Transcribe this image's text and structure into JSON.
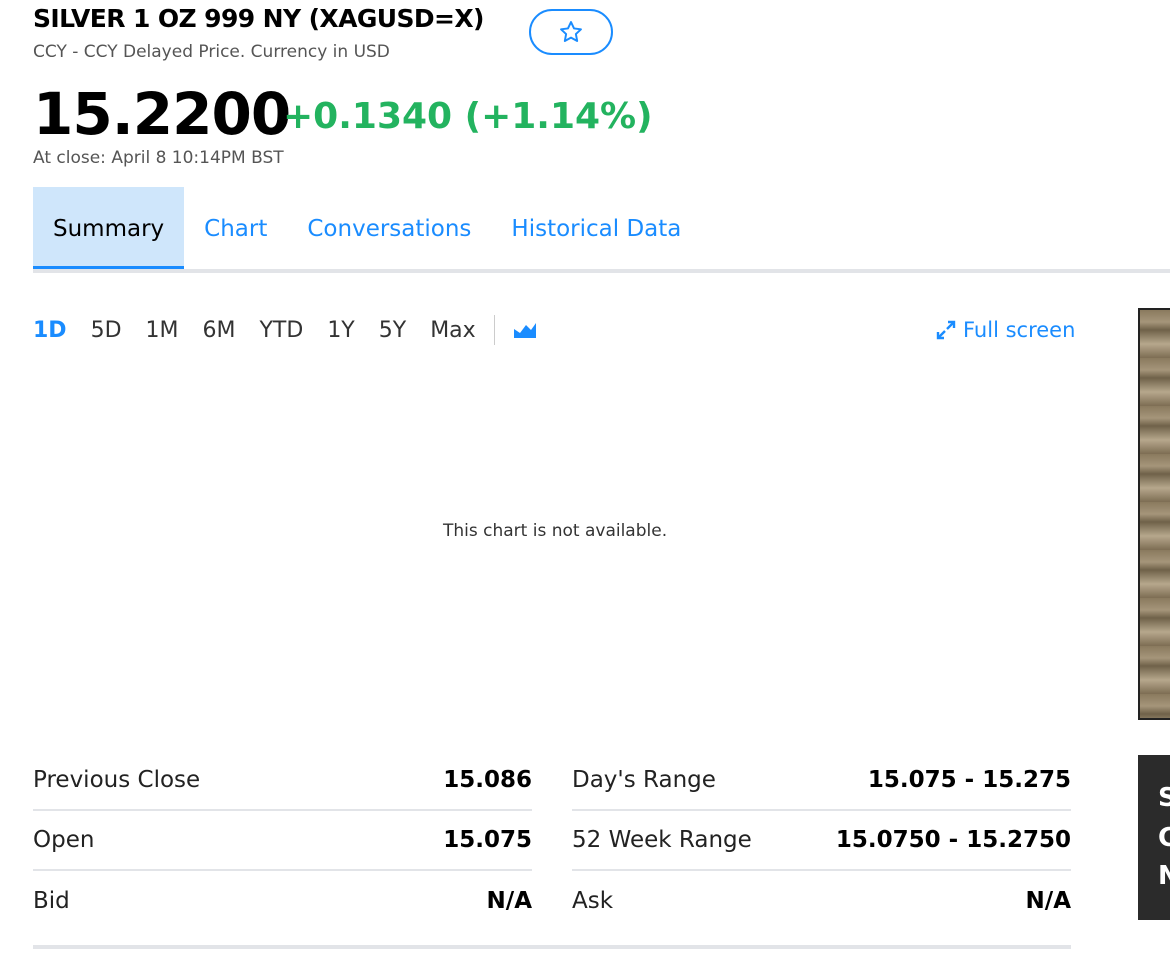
{
  "header": {
    "title": "SILVER 1 OZ 999 NY (XAGUSD=X)",
    "subtitle": "CCY - CCY Delayed Price. Currency in USD",
    "price": "15.2200",
    "change": "+0.1340 (+1.14%)",
    "close_time": "At close: April 8 10:14PM BST"
  },
  "tabs": [
    {
      "label": "Summary",
      "active": true
    },
    {
      "label": "Chart",
      "active": false
    },
    {
      "label": "Conversations",
      "active": false
    },
    {
      "label": "Historical Data",
      "active": false
    }
  ],
  "chart_toolbar": {
    "ranges": [
      "1D",
      "5D",
      "1M",
      "6M",
      "YTD",
      "1Y",
      "5Y",
      "Max"
    ],
    "active_range": "1D",
    "fullscreen_label": "Full screen"
  },
  "chart_message": "This chart is not available.",
  "stats_left": [
    {
      "label": "Previous Close",
      "value": "15.086"
    },
    {
      "label": "Open",
      "value": "15.075"
    },
    {
      "label": "Bid",
      "value": "N/A"
    }
  ],
  "stats_right": [
    {
      "label": "Day's Range",
      "value": "15.075 - 15.275"
    },
    {
      "label": "52 Week Range",
      "value": "15.0750 - 15.2750"
    },
    {
      "label": "Ask",
      "value": "N/A"
    }
  ],
  "ad": {
    "letters": [
      "S",
      "C",
      "N"
    ]
  },
  "colors": {
    "accent": "#1a8cff",
    "positive": "#23b35f",
    "active_tab_bg": "#cfe6fb",
    "divider": "#e2e4e8"
  }
}
